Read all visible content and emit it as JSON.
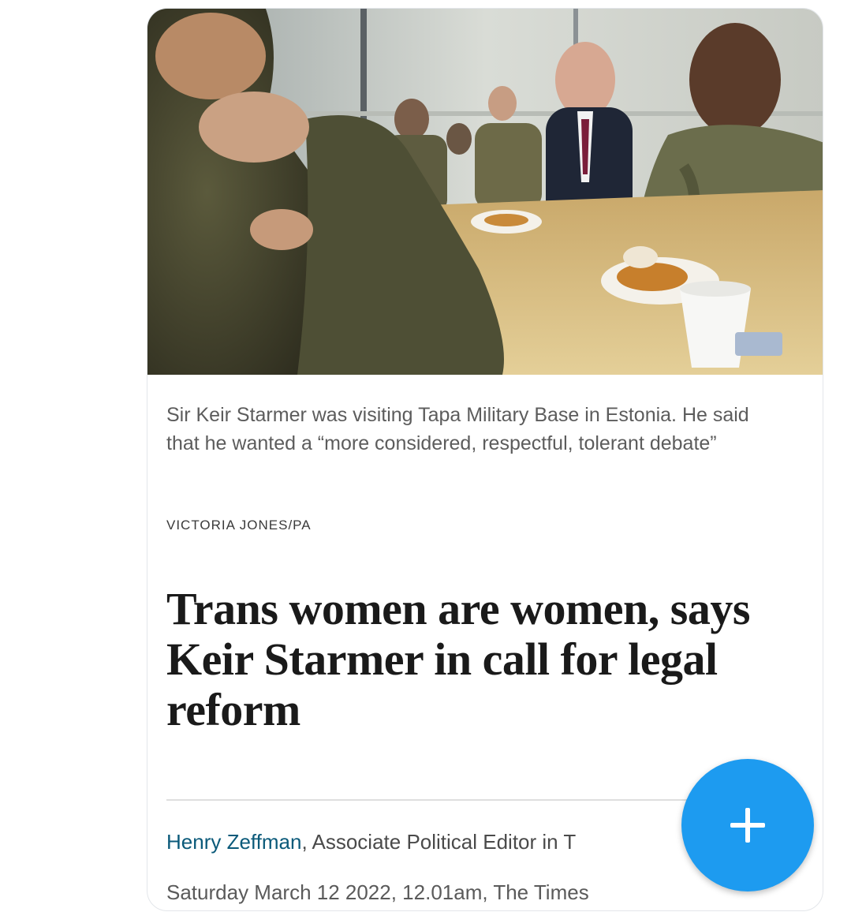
{
  "article": {
    "photo": {
      "alt_icon": "news-photo"
    },
    "caption": "Sir Keir Starmer was visiting Tapa Military Base in Estonia. He said that he wanted a “more considered, respectful, tolerant debate”",
    "photo_credit": "VICTORIA JONES/PA",
    "headline": "Trans women are women, says Keir Starmer in call for legal reform",
    "byline": {
      "author": "Henry Zeffman",
      "role": ", Associate Political Editor in T"
    },
    "dateline": "Saturday March 12 2022, 12.01am, The Times"
  },
  "fab": {
    "icon": "plus-icon",
    "color": "#1d9bf0"
  },
  "colors": {
    "author_link": "#0b5a7a",
    "fab_blue": "#1d9bf0"
  }
}
